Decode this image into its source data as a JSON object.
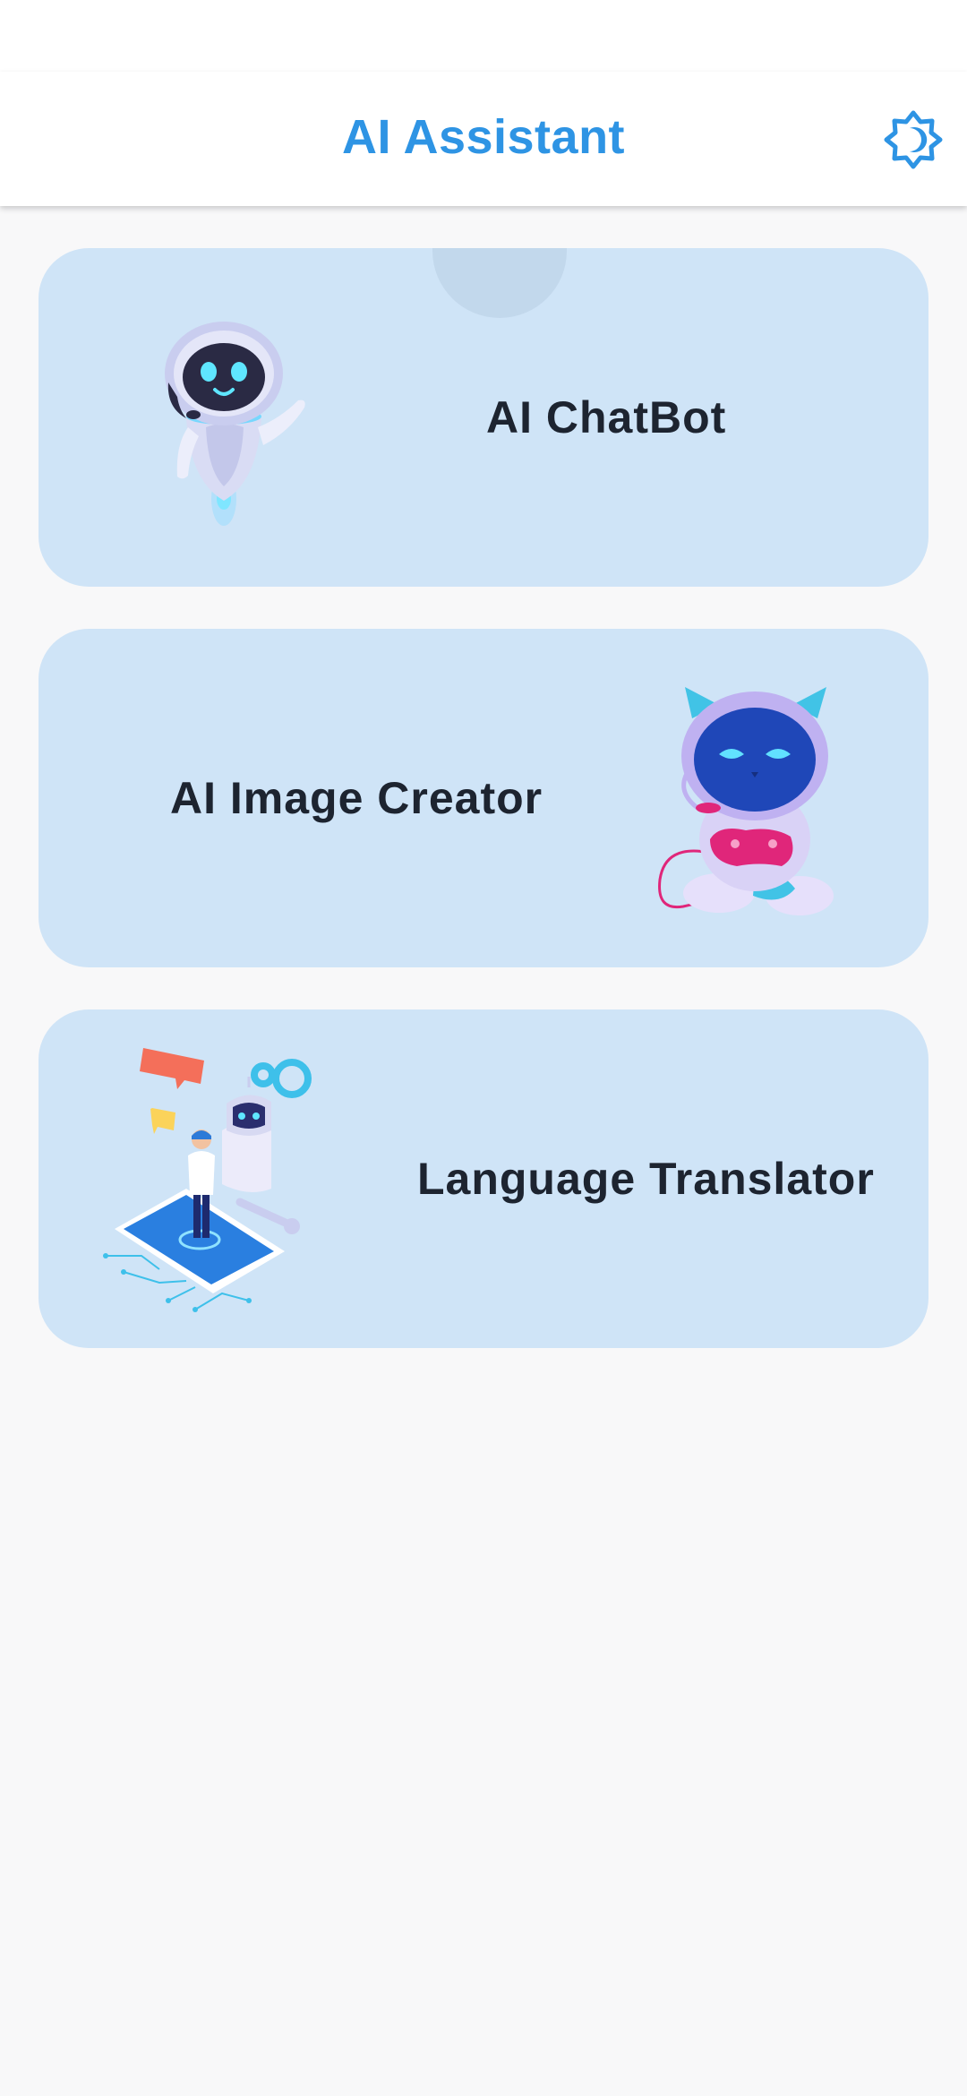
{
  "app_bar": {
    "title": "AI Assistant",
    "theme_toggle_icon": "brightness-contrast-icon"
  },
  "colors": {
    "accent": "#2e94e4",
    "card_background": "#cfe4f7",
    "page_background": "#f8f8f9",
    "label_text": "#1d2430"
  },
  "cards": [
    {
      "label": "AI ChatBot",
      "illustration": "floating-robot-icon"
    },
    {
      "label": "AI Image Creator",
      "illustration": "gamer-robot-icon"
    },
    {
      "label": "Language Translator",
      "illustration": "translator-robot-icon"
    }
  ]
}
